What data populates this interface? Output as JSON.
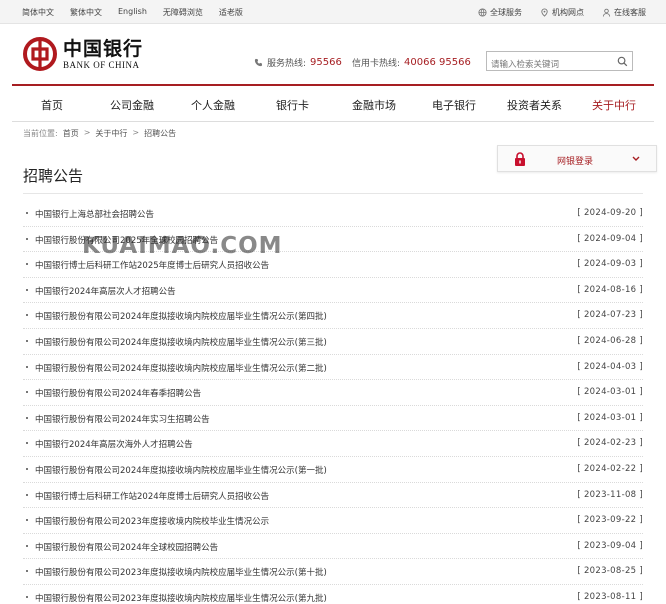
{
  "topbar": {
    "lang_simplified": "简体中文",
    "lang_traditional": "繁体中文",
    "lang_english": "English",
    "accessibility": "无障碍浏览",
    "elderly": "适老版",
    "global_service": "全球服务",
    "branches": "机构网点",
    "online_support": "在线客服"
  },
  "logo": {
    "cn": "中国银行",
    "en": "BANK OF CHINA"
  },
  "hotline": {
    "service_label": "服务热线:",
    "service_number": "95566",
    "card_label": "信用卡热线:",
    "card_number": "40066 95566"
  },
  "search": {
    "placeholder": "请输入检索关键词"
  },
  "nav": [
    {
      "label": "首页"
    },
    {
      "label": "公司金融"
    },
    {
      "label": "个人金融"
    },
    {
      "label": "银行卡"
    },
    {
      "label": "金融市场"
    },
    {
      "label": "电子银行"
    },
    {
      "label": "投资者关系"
    },
    {
      "label": "关于中行"
    }
  ],
  "breadcrumb": {
    "prefix": "当前位置:",
    "home": "首页",
    "sep": ">",
    "parent": "关于中行",
    "current": "招聘公告"
  },
  "page_title": "招聘公告",
  "login": {
    "label": "网银登录"
  },
  "watermark": "KUAIMAO.COM",
  "items": [
    {
      "title": "中国银行上海总部社会招聘公告",
      "date": "[ 2024-09-20 ]"
    },
    {
      "title": "中国银行股份有限公司2025年全球校园招聘公告",
      "date": "[ 2024-09-04 ]"
    },
    {
      "title": "中国银行博士后科研工作站2025年度博士后研究人员招收公告",
      "date": "[ 2024-09-03 ]"
    },
    {
      "title": "中国银行2024年高层次人才招聘公告",
      "date": "[ 2024-08-16 ]"
    },
    {
      "title": "中国银行股份有限公司2024年度拟接收境内院校应届毕业生情况公示(第四批)",
      "date": "[ 2024-07-23 ]"
    },
    {
      "title": "中国银行股份有限公司2024年度拟接收境内院校应届毕业生情况公示(第三批)",
      "date": "[ 2024-06-28 ]"
    },
    {
      "title": "中国银行股份有限公司2024年度拟接收境内院校应届毕业生情况公示(第二批)",
      "date": "[ 2024-04-03 ]"
    },
    {
      "title": "中国银行股份有限公司2024年春季招聘公告",
      "date": "[ 2024-03-01 ]"
    },
    {
      "title": "中国银行股份有限公司2024年实习生招聘公告",
      "date": "[ 2024-03-01 ]"
    },
    {
      "title": "中国银行2024年高层次海外人才招聘公告",
      "date": "[ 2024-02-23 ]"
    },
    {
      "title": "中国银行股份有限公司2024年度拟接收境内院校应届毕业生情况公示(第一批)",
      "date": "[ 2024-02-22 ]"
    },
    {
      "title": "中国银行博士后科研工作站2024年度博士后研究人员招收公告",
      "date": "[ 2023-11-08 ]"
    },
    {
      "title": "中国银行股份有限公司2023年度接收境内院校毕业生情况公示",
      "date": "[ 2023-09-22 ]"
    },
    {
      "title": "中国银行股份有限公司2024年全球校园招聘公告",
      "date": "[ 2023-09-04 ]"
    },
    {
      "title": "中国银行股份有限公司2023年度拟接收境内院校应届毕业生情况公示(第十批)",
      "date": "[ 2023-08-25 ]"
    },
    {
      "title": "中国银行股份有限公司2023年度拟接收境内院校应届毕业生情况公示(第九批)",
      "date": "[ 2023-08-11 ]"
    }
  ]
}
